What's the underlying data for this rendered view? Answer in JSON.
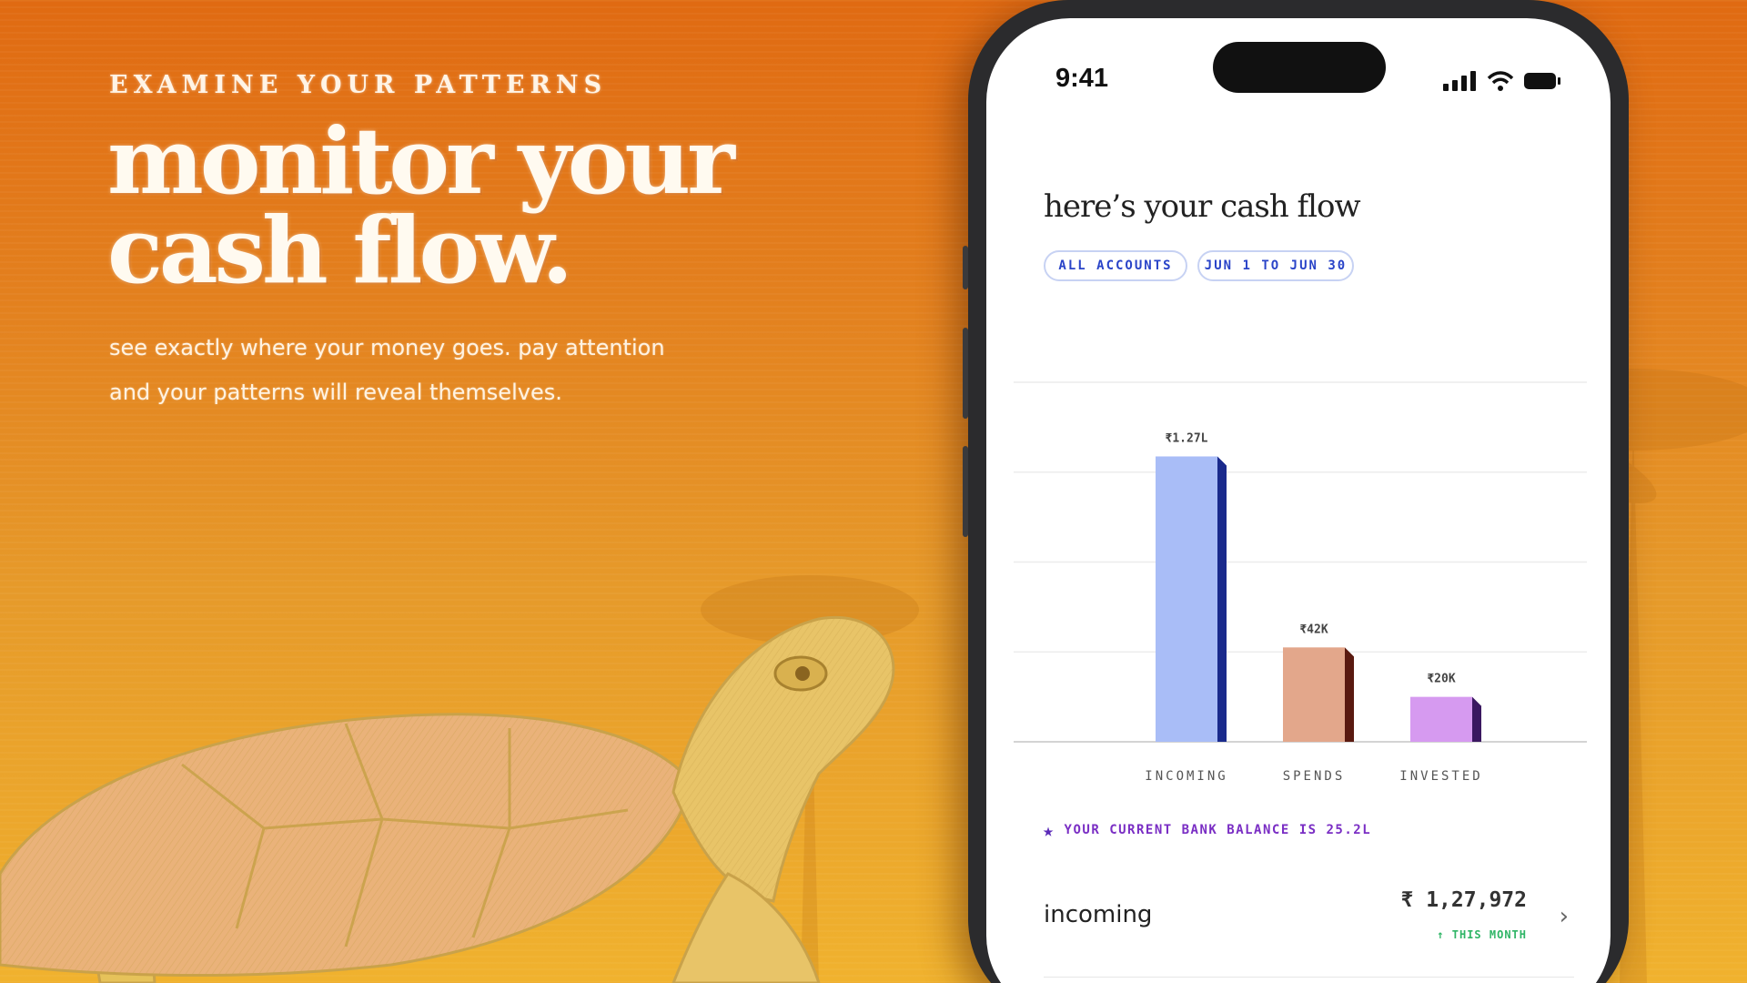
{
  "hero": {
    "eyebrow": "EXAMINE YOUR PATTERNS",
    "headline_line1": "monitor your",
    "headline_line2": "cash flow.",
    "subtext_line1": "see exactly where your money goes. pay attention",
    "subtext_line2": "and your patterns will reveal themselves."
  },
  "phone": {
    "status_time": "9:41",
    "title": "here’s your cash flow",
    "chips": {
      "accounts": "ALL ACCOUNTS",
      "range": "JUN 1 TO JUN 30"
    },
    "balance_note": "YOUR CURRENT BANK BALANCE IS 25.2L",
    "row": {
      "label": "incoming",
      "amount": "₹ 1,27,972",
      "sub": "↑ THIS MONTH",
      "chevron": "›"
    }
  },
  "colors": {
    "incoming": "#a9bdf7",
    "incoming_side": "#1a2a8c",
    "spends": "#e3a78b",
    "spends_side": "#5a1a10",
    "invested": "#d69af0",
    "invested_side": "#3a1860",
    "chip_text": "#2a44c8",
    "balance_text": "#7a2ec4"
  },
  "chart_data": {
    "type": "bar",
    "categories": [
      "INCOMING",
      "SPENDS",
      "INVESTED"
    ],
    "values": [
      127000,
      42000,
      20000
    ],
    "data_labels": [
      "₹1.27L",
      "₹42K",
      "₹20K"
    ],
    "title": "",
    "xlabel": "",
    "ylabel": "",
    "ylim": [
      0,
      160000
    ],
    "grid": true
  }
}
